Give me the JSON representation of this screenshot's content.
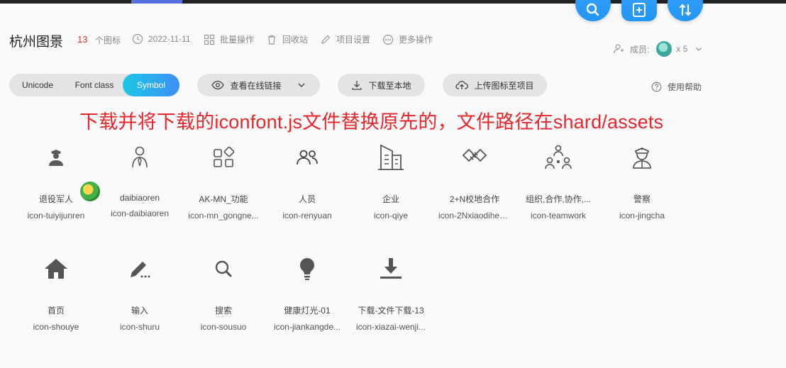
{
  "header": {
    "project_title": "杭州图景",
    "icon_count": "13",
    "icon_count_label": "个图标",
    "date": "2022-11-11",
    "batch_label": "批量操作",
    "recycle_label": "回收站",
    "settings_label": "项目设置",
    "more_label": "更多操作",
    "members_label": "成员:",
    "members_count": "x 5"
  },
  "toolbar": {
    "tabs": [
      "Unicode",
      "Font class",
      "Symbol"
    ],
    "active_tab": "Symbol",
    "view_link_label": "查看在线链接",
    "download_label": "下载至本地",
    "upload_label": "上传图标至项目",
    "help_label": "使用帮助"
  },
  "annotation": "下载并将下载的iconfont.js文件替换原先的，文件路径在shard/assets",
  "icons": [
    {
      "name": "退役军人",
      "code": "icon-tuiyijunren",
      "icon": "soldier-icon"
    },
    {
      "name": "daibiaoren",
      "code": "icon-daibiaoren",
      "icon": "representative-icon"
    },
    {
      "name": "AK-MN_功能",
      "code": "icon-mn_gongne...",
      "icon": "function-grid-icon"
    },
    {
      "name": "人员",
      "code": "icon-renyuan",
      "icon": "people-icon"
    },
    {
      "name": "企业",
      "code": "icon-qiye",
      "icon": "building-icon"
    },
    {
      "name": "2+N校地合作",
      "code": "icon-2Nxiaodihez...",
      "icon": "handshake-icon"
    },
    {
      "name": "组织,合作,协作,...",
      "code": "icon-teamwork",
      "icon": "teamwork-icon"
    },
    {
      "name": "警察",
      "code": "icon-jingcha",
      "icon": "police-icon"
    },
    {
      "name": "首页",
      "code": "icon-shouye",
      "icon": "home-icon"
    },
    {
      "name": "输入",
      "code": "icon-shuru",
      "icon": "pen-icon"
    },
    {
      "name": "搜索",
      "code": "icon-sousuo",
      "icon": "search-icon"
    },
    {
      "name": "健康灯光-01",
      "code": "icon-jiankangde...",
      "icon": "lightbulb-icon"
    },
    {
      "name": "下载-文件下载-13",
      "code": "icon-xiazai-wenji...",
      "icon": "download-icon"
    }
  ]
}
